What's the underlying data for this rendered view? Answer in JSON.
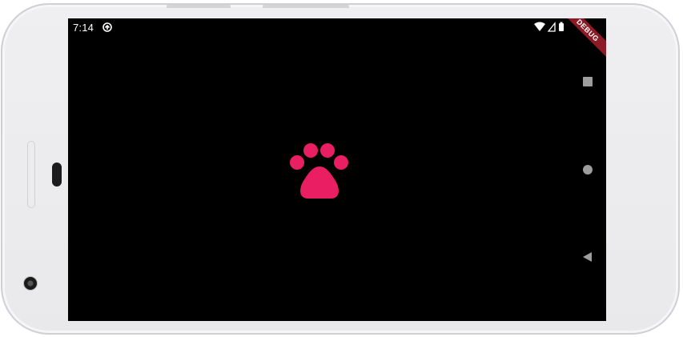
{
  "status_bar": {
    "time": "7:14",
    "sync_icon": "sync-icon",
    "wifi_icon": "wifi-icon",
    "signal_icon": "signal-icon",
    "battery_icon": "battery-icon"
  },
  "debug_banner": {
    "label": "DEBUG",
    "color": "#8d1b25"
  },
  "content": {
    "icon": "paw-icon",
    "icon_color": "#e91e63",
    "background": "#000000"
  },
  "nav_bar": {
    "recent_icon": "recent-apps-icon",
    "home_icon": "home-icon",
    "back_icon": "back-icon"
  }
}
